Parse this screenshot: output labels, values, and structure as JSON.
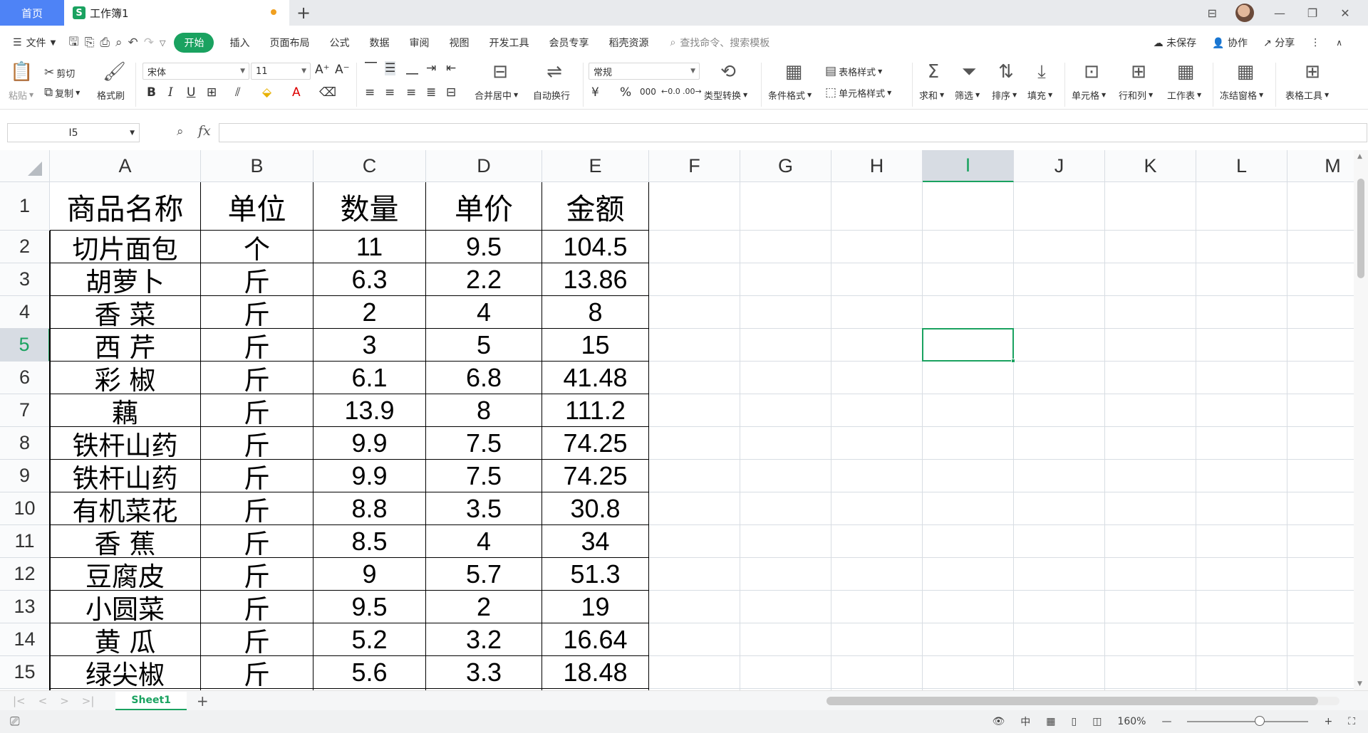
{
  "titlebar": {
    "home_tab": "首页",
    "doc_tab": "工作簿1",
    "doc_icon": "S",
    "add_tab": "+",
    "window_buttons": [
      "—",
      "❐",
      "✕"
    ]
  },
  "menubar": {
    "file": "文件",
    "tabs": [
      "开始",
      "插入",
      "页面布局",
      "公式",
      "数据",
      "审阅",
      "视图",
      "开发工具",
      "会员专享",
      "稻壳资源"
    ],
    "active_tab": "开始",
    "search_placeholder": "查找命令、搜索模板",
    "unsaved": "未保存",
    "collaborate": "协作",
    "share": "分享"
  },
  "ribbon": {
    "paste": "粘贴",
    "cut": "剪切",
    "copy": "复制",
    "format_painter": "格式刷",
    "font_name": "宋体",
    "font_size": "11",
    "merge_center": "合并居中",
    "wrap_text": "自动换行",
    "number_format": "常规",
    "type_convert": "类型转换",
    "conditional_format": "条件格式",
    "table_style": "表格样式",
    "cell_style": "单元格样式",
    "sum": "求和",
    "filter": "筛选",
    "sort": "排序",
    "fill": "填充",
    "cell": "单元格",
    "rows_cols": "行和列",
    "worksheet": "工作表",
    "freeze": "冻结窗格",
    "table_tools": "表格工具"
  },
  "formulabar": {
    "name_box": "I5",
    "fx": "fx",
    "formula": ""
  },
  "grid": {
    "columns": [
      "A",
      "B",
      "C",
      "D",
      "E",
      "F",
      "G",
      "H",
      "I",
      "J",
      "K",
      "L",
      "M"
    ],
    "active_column": "I",
    "active_row": 5,
    "row_numbers": [
      "1",
      "2",
      "3",
      "4",
      "5",
      "6",
      "7",
      "8",
      "9",
      "10",
      "11",
      "12",
      "13",
      "14",
      "15",
      ""
    ],
    "header": [
      "商品名称",
      "单位",
      "数量",
      "单价",
      "金额"
    ],
    "rows": [
      [
        "切片面包",
        "个",
        "11",
        "9.5",
        "104.5"
      ],
      [
        "胡萝卜",
        "斤",
        "6.3",
        "2.2",
        "13.86"
      ],
      [
        "香  菜",
        "斤",
        "2",
        "4",
        "8"
      ],
      [
        "西  芹",
        "斤",
        "3",
        "5",
        "15"
      ],
      [
        "彩  椒",
        "斤",
        "6.1",
        "6.8",
        "41.48"
      ],
      [
        "藕",
        "斤",
        "13.9",
        "8",
        "111.2"
      ],
      [
        "铁杆山药",
        "斤",
        "9.9",
        "7.5",
        "74.25"
      ],
      [
        "铁杆山药",
        "斤",
        "9.9",
        "7.5",
        "74.25"
      ],
      [
        "有机菜花",
        "斤",
        "8.8",
        "3.5",
        "30.8"
      ],
      [
        "香  蕉",
        "斤",
        "8.5",
        "4",
        "34"
      ],
      [
        "豆腐皮",
        "斤",
        "9",
        "5.7",
        "51.3"
      ],
      [
        "小圆菜",
        "斤",
        "9.5",
        "2",
        "19"
      ],
      [
        "黄  瓜",
        "斤",
        "5.2",
        "3.2",
        "16.64"
      ],
      [
        "绿尖椒",
        "斤",
        "5.6",
        "3.3",
        "18.48"
      ]
    ]
  },
  "sheetbar": {
    "sheet_tab": "Sheet1",
    "add_sheet": "+"
  },
  "statusbar": {
    "zoom": "160%",
    "zoom_out": "—",
    "zoom_in": "+"
  }
}
